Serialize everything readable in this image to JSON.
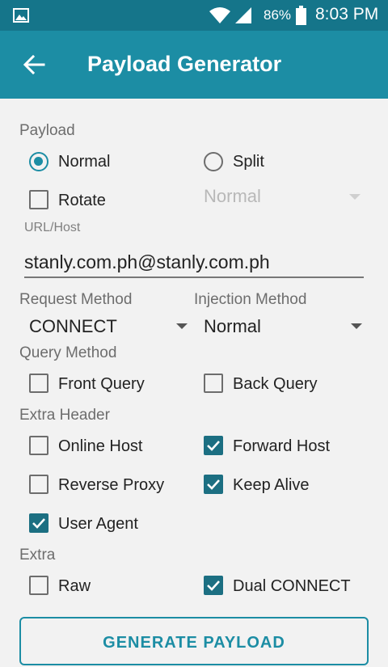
{
  "status_bar": {
    "battery_percent": "86%",
    "time": "8:03 PM",
    "icons": [
      "gallery-icon",
      "wifi-icon",
      "signal-icon",
      "battery-icon"
    ]
  },
  "app_bar": {
    "title": "Payload Generator",
    "back_icon": "arrow-left-icon"
  },
  "payload": {
    "label": "Payload",
    "options": [
      {
        "label": "Normal",
        "selected": true
      },
      {
        "label": "Split",
        "selected": false
      }
    ],
    "rotate": {
      "label": "Rotate",
      "checked": false
    },
    "split_select_value": "Normal"
  },
  "url_host": {
    "label": "URL/Host",
    "value": "stanly.com.ph@stanly.com.ph"
  },
  "request_method": {
    "label": "Request Method",
    "value": "CONNECT"
  },
  "injection_method": {
    "label": "Injection Method",
    "value": "Normal"
  },
  "query_method": {
    "label": "Query Method",
    "front": {
      "label": "Front Query",
      "checked": false
    },
    "back": {
      "label": "Back Query",
      "checked": false
    }
  },
  "extra_header": {
    "label": "Extra Header",
    "online_host": {
      "label": "Online Host",
      "checked": false
    },
    "forward_host": {
      "label": "Forward Host",
      "checked": true
    },
    "reverse_proxy": {
      "label": "Reverse Proxy",
      "checked": false
    },
    "keep_alive": {
      "label": "Keep Alive",
      "checked": true
    },
    "user_agent": {
      "label": "User Agent",
      "checked": true
    }
  },
  "extra": {
    "label": "Extra",
    "raw": {
      "label": "Raw",
      "checked": false
    },
    "dual_connect": {
      "label": "Dual CONNECT",
      "checked": true
    }
  },
  "generate_button": {
    "label": "GENERATE PAYLOAD"
  },
  "colors": {
    "status_bar": "#15758a",
    "app_bar": "#1c8da4",
    "checkbox_checked": "#1c6f82",
    "background": "#f2f2f2"
  }
}
